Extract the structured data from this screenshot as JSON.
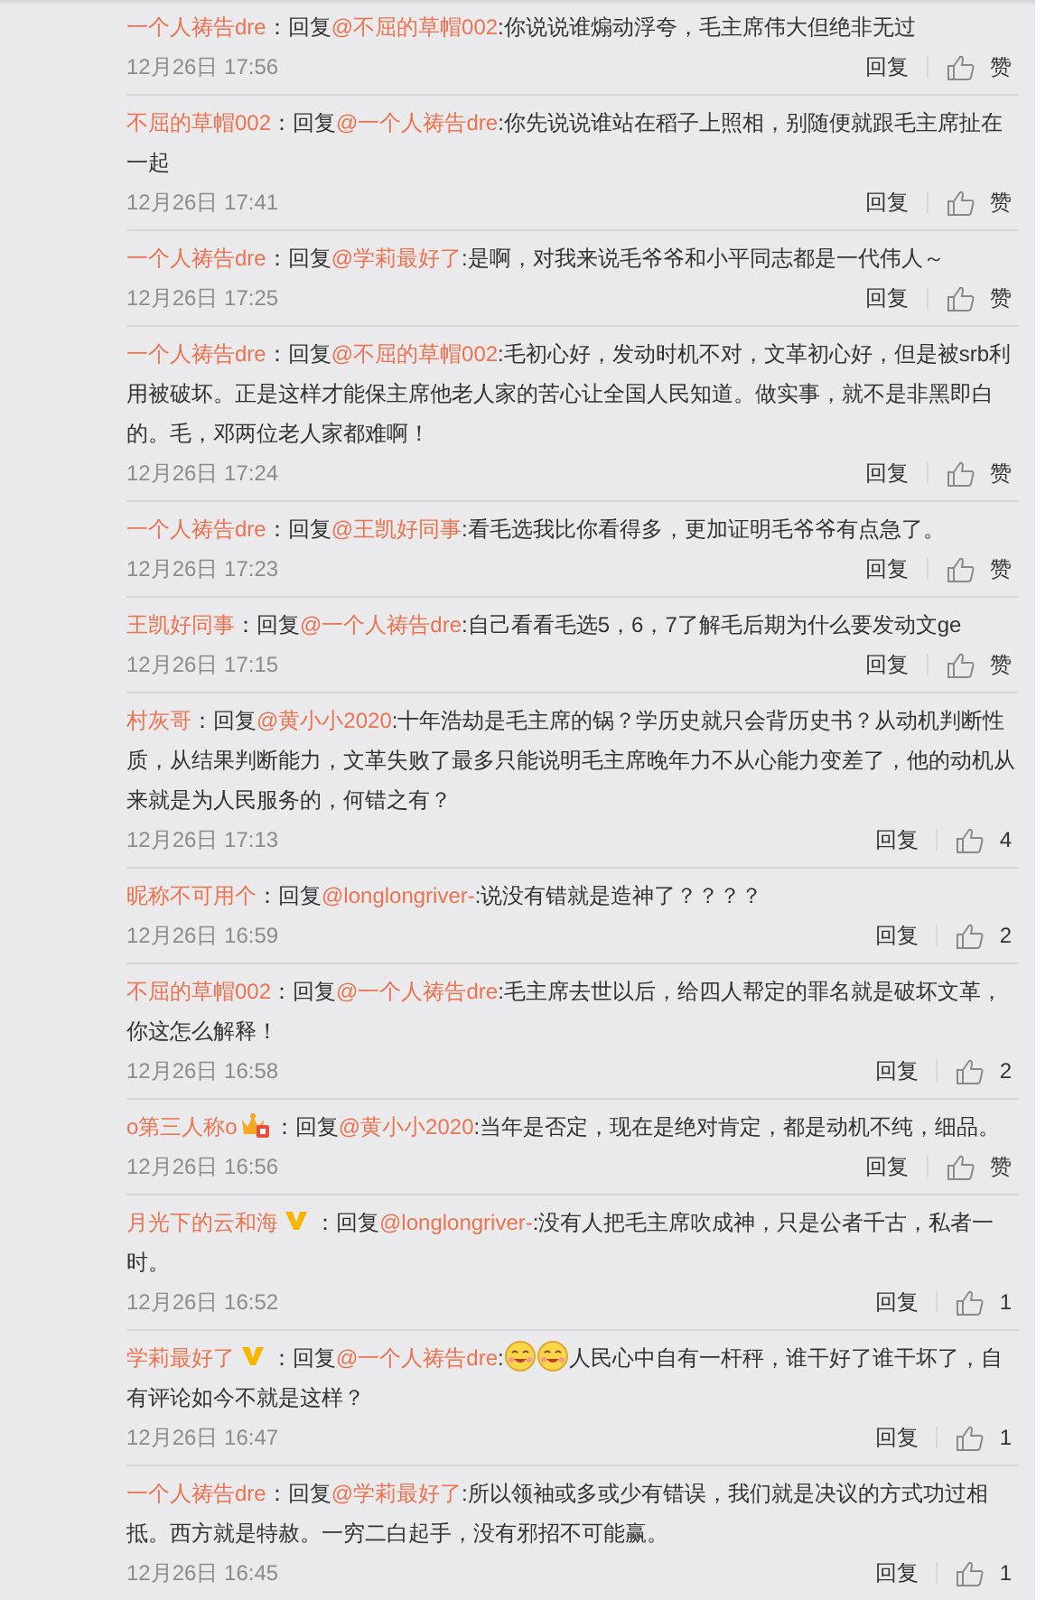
{
  "comments": [
    {
      "author": "一个人祷告dre",
      "separator": "：",
      "reply_label": "回复",
      "reply_to": "@不屈的草帽002",
      "text": ":你说说谁煽动浮夸，毛主席伟大但绝非无过",
      "date": "12月26日 17:56",
      "reply_button": "回复",
      "likes": "赞"
    },
    {
      "author": "不屈的草帽002",
      "separator": "：",
      "reply_label": "回复",
      "reply_to": "@一个人祷告dre",
      "text": ":你先说说谁站在稻子上照相，别随便就跟毛主席扯在一起",
      "date": "12月26日 17:41",
      "reply_button": "回复",
      "likes": "赞"
    },
    {
      "author": "一个人祷告dre",
      "separator": "：",
      "reply_label": "回复",
      "reply_to": "@学莉最好了",
      "text": ":是啊，对我来说毛爷爷和小平同志都是一代伟人～",
      "date": "12月26日 17:25",
      "reply_button": "回复",
      "likes": "赞"
    },
    {
      "author": "一个人祷告dre",
      "separator": "：",
      "reply_label": "回复",
      "reply_to": "@不屈的草帽002",
      "text": ":毛初心好，发动时机不对，文革初心好，但是被srb利用被破坏。正是这样才能保主席他老人家的苦心让全国人民知道。做实事，就不是非黑即白的。毛，邓两位老人家都难啊！",
      "date": "12月26日 17:24",
      "reply_button": "回复",
      "likes": "赞"
    },
    {
      "author": "一个人祷告dre",
      "separator": "：",
      "reply_label": "回复",
      "reply_to": "@王凯好同事",
      "text": ":看毛选我比你看得多，更加证明毛爷爷有点急了。",
      "date": "12月26日 17:23",
      "reply_button": "回复",
      "likes": "赞"
    },
    {
      "author": "王凯好同事",
      "separator": "：",
      "reply_label": "回复",
      "reply_to": "@一个人祷告dre",
      "text": ":自己看看毛选5，6，7了解毛后期为什么要发动文ge",
      "date": "12月26日 17:15",
      "reply_button": "回复",
      "likes": "赞"
    },
    {
      "author": "村灰哥",
      "separator": "：",
      "reply_label": "回复",
      "reply_to": "@黄小小2020",
      "text": ":十年浩劫是毛主席的锅？学历史就只会背历史书？从动机判断性质，从结果判断能力，文革失败了最多只能说明毛主席晚年力不从心能力变差了，他的动机从来就是为人民服务的，何错之有？",
      "date": "12月26日 17:13",
      "reply_button": "回复",
      "likes": "4"
    },
    {
      "author": "昵称不可用个",
      "separator": "：",
      "reply_label": "回复",
      "reply_to": "@longlongriver-",
      "text": ":说没有错就是造神了？？？？",
      "date": "12月26日 16:59",
      "reply_button": "回复",
      "likes": "2"
    },
    {
      "author": "不屈的草帽002",
      "separator": "：",
      "reply_label": "回复",
      "reply_to": "@一个人祷告dre",
      "text": ":毛主席去世以后，给四人帮定的罪名就是破坏文革，你这怎么解释！",
      "date": "12月26日 16:58",
      "reply_button": "回复",
      "likes": "2"
    },
    {
      "author": "o第三人称o",
      "badge": {
        "kind": "crown"
      },
      "separator": "：",
      "reply_label": "回复",
      "reply_to": "@黄小小2020",
      "text": ":当年是否定，现在是绝对肯定，都是动机不纯，细品。",
      "date": "12月26日 16:56",
      "reply_button": "回复",
      "likes": "赞"
    },
    {
      "author": "月光下的云和海",
      "badge": {
        "kind": "verified"
      },
      "separator": "：",
      "reply_label": "回复",
      "reply_to": "@longlongriver-",
      "text": ":没有人把毛主席吹成神，只是公者千古，私者一时。",
      "date": "12月26日 16:52",
      "reply_button": "回复",
      "likes": "1"
    },
    {
      "author": "学莉最好了",
      "badge": {
        "kind": "verified"
      },
      "separator": "：",
      "reply_label": "回复",
      "reply_to": "@一个人祷告dre",
      "text": ":",
      "emojis": [
        {
          "kind": "smile"
        },
        {
          "kind": "smile"
        }
      ],
      "text_after": "人民心中自有一杆秤，谁干好了谁干坏了，自有评论如今不就是这样？",
      "date": "12月26日 16:47",
      "reply_button": "回复",
      "likes": "1"
    },
    {
      "author": "一个人祷告dre",
      "separator": "：",
      "reply_label": "回复",
      "reply_to": "@学莉最好了",
      "text": ":所以领袖或多或少有错误，我们就是决议的方式功过相抵。西方就是特赦。一穷二白起手，没有邪招不可能赢。",
      "date": "12月26日 16:45",
      "reply_button": "回复",
      "likes": "1"
    }
  ]
}
